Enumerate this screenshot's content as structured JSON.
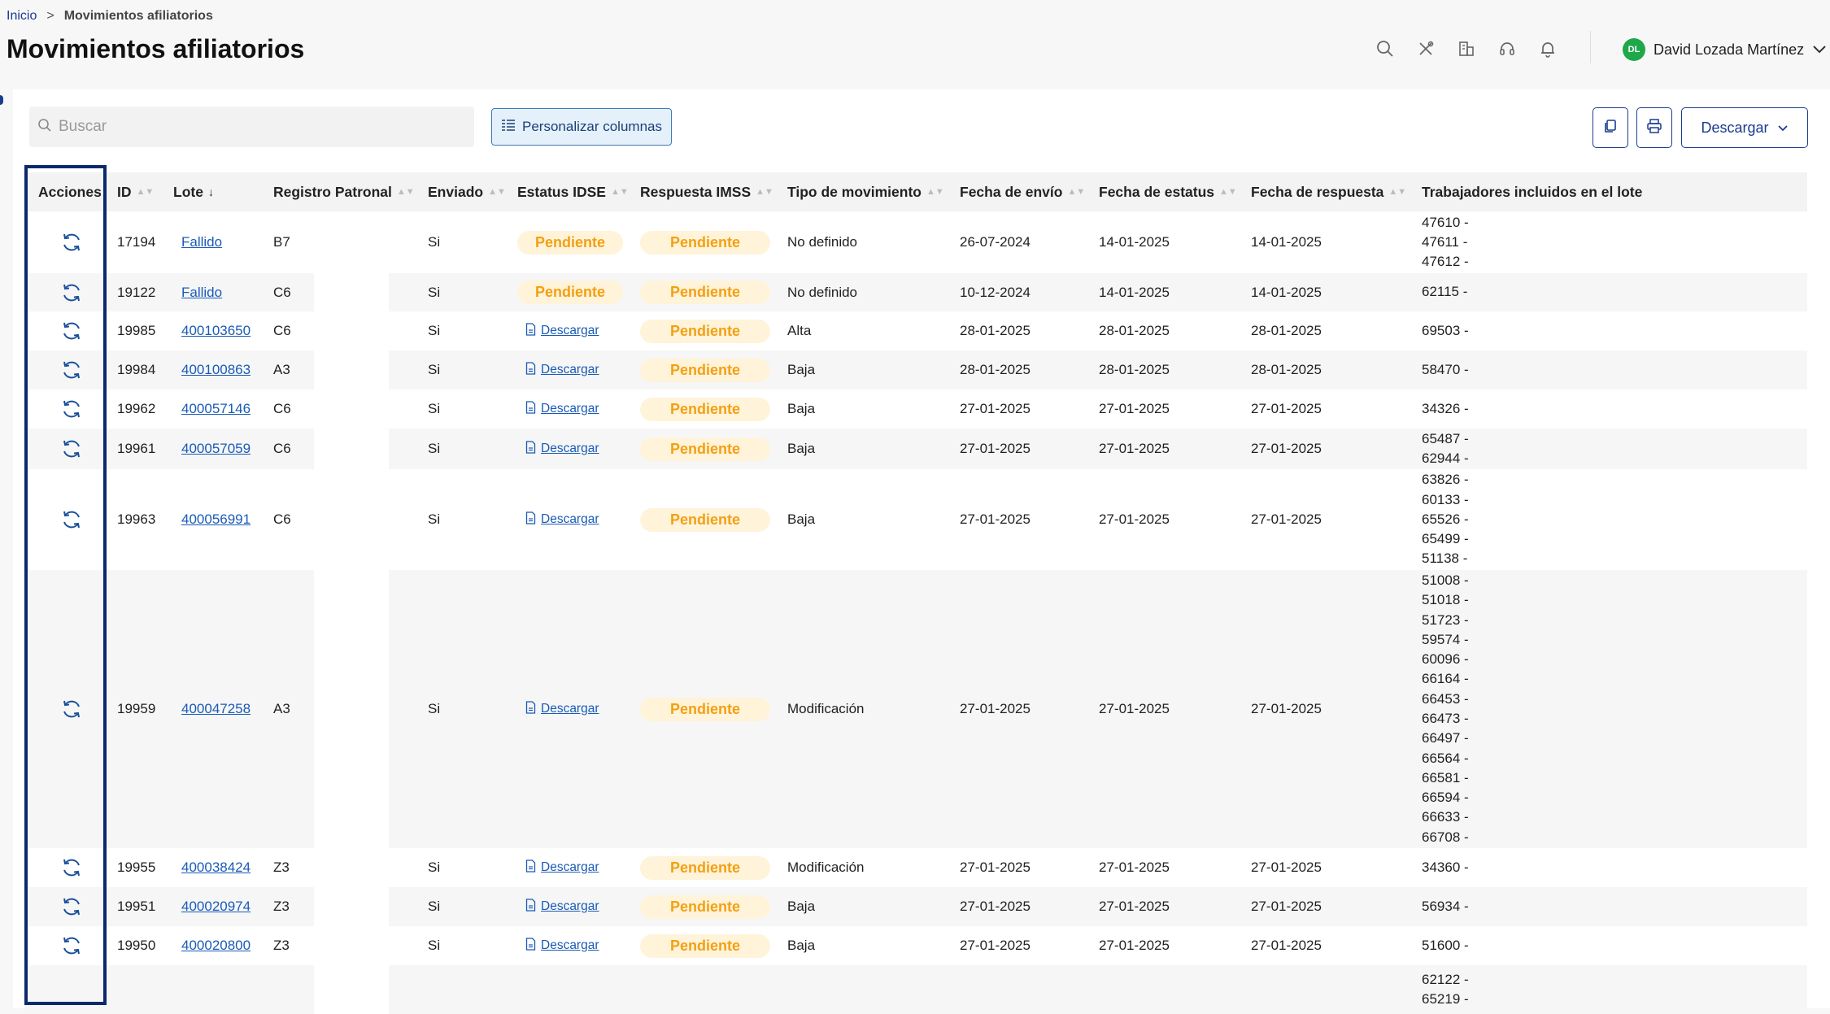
{
  "breadcrumb": {
    "home": "Inicio",
    "separator": ">",
    "current": "Movimientos afiliatorios"
  },
  "page_title": "Movimientos afiliatorios",
  "header": {
    "icons": [
      "search-icon",
      "tools-icon",
      "building-icon",
      "headset-icon",
      "bell-icon"
    ],
    "user": {
      "initials": "DL",
      "name": "David Lozada Martínez"
    }
  },
  "toolbar": {
    "search_placeholder": "Buscar",
    "columns_button": "Personalizar columnas",
    "download_button": "Descargar"
  },
  "columns": {
    "acciones": "Acciones",
    "id": "ID",
    "lote": "Lote",
    "registro": "Registro Patronal",
    "enviado": "Enviado",
    "estatus": "Estatus IDSE",
    "respuesta": "Respuesta IMSS",
    "tipo": "Tipo de movimiento",
    "envio": "Fecha de envío",
    "fecha_estatus": "Fecha de estatus",
    "fecha_respuesta": "Fecha de respuesta",
    "trabajadores": "Trabajadores incluidos en el lote"
  },
  "rows": [
    {
      "id": "17194",
      "lote": "Fallido",
      "registro": "B7",
      "enviado": "Si",
      "estatus": "Pendiente",
      "respuesta": "Pendiente",
      "tipo": "No definido",
      "envio": "26-07-2024",
      "fecha_estatus": "14-01-2025",
      "fecha_respuesta": "14-01-2025",
      "trabajadores": [
        "47610 -",
        "47611 -",
        "47612 -"
      ]
    },
    {
      "id": "19122",
      "lote": "Fallido",
      "registro": "C6",
      "enviado": "Si",
      "estatus": "Pendiente",
      "respuesta": "Pendiente",
      "tipo": "No definido",
      "envio": "10-12-2024",
      "fecha_estatus": "14-01-2025",
      "fecha_respuesta": "14-01-2025",
      "trabajadores": [
        "62115 -"
      ]
    },
    {
      "id": "19985",
      "lote": "400103650",
      "registro": "C6",
      "enviado": "Si",
      "estatus": "Descargar",
      "respuesta": "Pendiente",
      "tipo": "Alta",
      "envio": "28-01-2025",
      "fecha_estatus": "28-01-2025",
      "fecha_respuesta": "28-01-2025",
      "trabajadores": [
        "69503 -"
      ]
    },
    {
      "id": "19984",
      "lote": "400100863",
      "registro": "A3",
      "enviado": "Si",
      "estatus": "Descargar",
      "respuesta": "Pendiente",
      "tipo": "Baja",
      "envio": "28-01-2025",
      "fecha_estatus": "28-01-2025",
      "fecha_respuesta": "28-01-2025",
      "trabajadores": [
        "58470 -"
      ]
    },
    {
      "id": "19962",
      "lote": "400057146",
      "registro": "C6",
      "enviado": "Si",
      "estatus": "Descargar",
      "respuesta": "Pendiente",
      "tipo": "Baja",
      "envio": "27-01-2025",
      "fecha_estatus": "27-01-2025",
      "fecha_respuesta": "27-01-2025",
      "trabajadores": [
        "34326 -"
      ]
    },
    {
      "id": "19961",
      "lote": "400057059",
      "registro": "C6",
      "enviado": "Si",
      "estatus": "Descargar",
      "respuesta": "Pendiente",
      "tipo": "Baja",
      "envio": "27-01-2025",
      "fecha_estatus": "27-01-2025",
      "fecha_respuesta": "27-01-2025",
      "trabajadores": [
        "65487 -",
        "62944 -"
      ]
    },
    {
      "id": "19963",
      "lote": "400056991",
      "registro": "C6",
      "enviado": "Si",
      "estatus": "Descargar",
      "respuesta": "Pendiente",
      "tipo": "Baja",
      "envio": "27-01-2025",
      "fecha_estatus": "27-01-2025",
      "fecha_respuesta": "27-01-2025",
      "trabajadores": [
        "63826 -",
        "60133 -",
        "65526 -",
        "65499 -",
        "51138 -"
      ]
    },
    {
      "id": "19959",
      "lote": "400047258",
      "registro": "A3",
      "enviado": "Si",
      "estatus": "Descargar",
      "respuesta": "Pendiente",
      "tipo": "Modificación",
      "envio": "27-01-2025",
      "fecha_estatus": "27-01-2025",
      "fecha_respuesta": "27-01-2025",
      "trabajadores": [
        "51008 -",
        "51018 -",
        "51723 -",
        "59574 -",
        "60096 -",
        "66164 -",
        "66453 -",
        "66473 -",
        "66497 -",
        "66564 -",
        "66581 -",
        "66594 -",
        "66633 -",
        "66708 -"
      ]
    },
    {
      "id": "19955",
      "lote": "400038424",
      "registro": "Z3",
      "enviado": "Si",
      "estatus": "Descargar",
      "respuesta": "Pendiente",
      "tipo": "Modificación",
      "envio": "27-01-2025",
      "fecha_estatus": "27-01-2025",
      "fecha_respuesta": "27-01-2025",
      "trabajadores": [
        "34360 -"
      ]
    },
    {
      "id": "19951",
      "lote": "400020974",
      "registro": "Z3",
      "enviado": "Si",
      "estatus": "Descargar",
      "respuesta": "Pendiente",
      "tipo": "Baja",
      "envio": "27-01-2025",
      "fecha_estatus": "27-01-2025",
      "fecha_respuesta": "27-01-2025",
      "trabajadores": [
        "56934 -"
      ]
    },
    {
      "id": "19950",
      "lote": "400020800",
      "registro": "Z3",
      "enviado": "Si",
      "estatus": "Descargar",
      "respuesta": "Pendiente",
      "tipo": "Baja",
      "envio": "27-01-2025",
      "fecha_estatus": "27-01-2025",
      "fecha_respuesta": "27-01-2025",
      "trabajadores": [
        "51600 -"
      ]
    },
    {
      "id": "",
      "lote": "",
      "registro": "",
      "enviado": "",
      "estatus": "",
      "respuesta": "",
      "tipo": "",
      "envio": "",
      "fecha_estatus": "",
      "fecha_respuesta": "",
      "trabajadores": [
        "62122 -",
        "65219 -"
      ]
    }
  ],
  "colors": {
    "accent": "#1a3c8f",
    "pending_bg": "#fff3d9",
    "pending_text": "#f3a012",
    "link": "#1a5bb5",
    "avatar": "#1ea84a"
  }
}
